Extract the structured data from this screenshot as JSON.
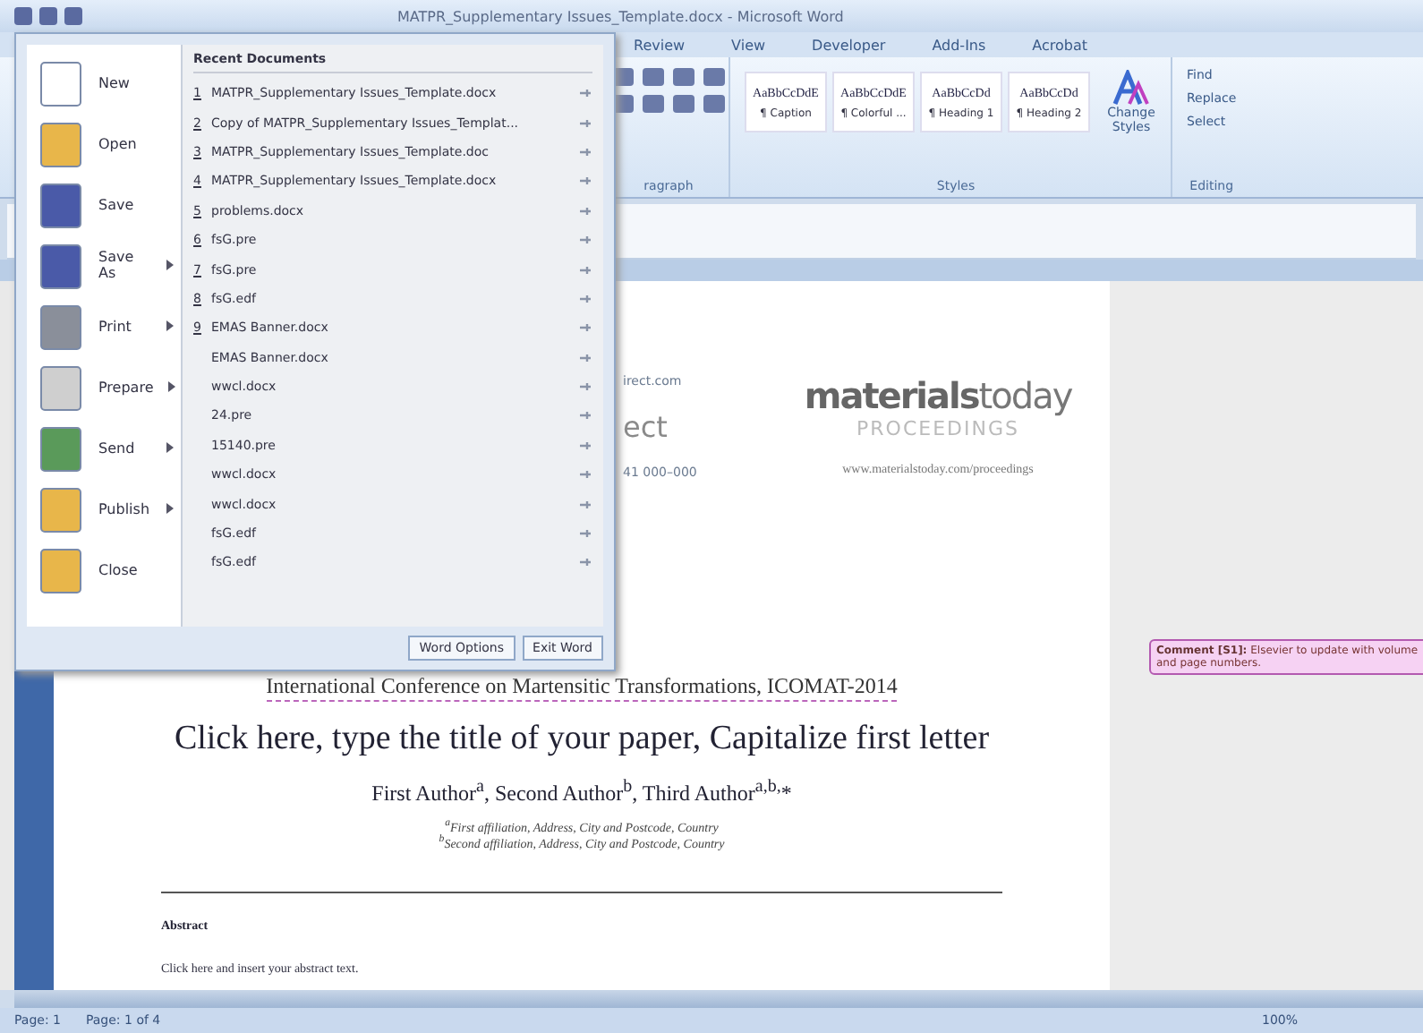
{
  "window": {
    "title": "MATPR_Supplementary Issues_Template.docx - Microsoft Word"
  },
  "ribbon_tabs": [
    {
      "label": "Review",
      "selected": false
    },
    {
      "label": "View",
      "selected": false
    },
    {
      "label": "Developer",
      "selected": false
    },
    {
      "label": "Add-Ins",
      "selected": false
    },
    {
      "label": "Acrobat",
      "selected": false
    }
  ],
  "paragraph_group": {
    "label": "ragraph"
  },
  "styles": [
    {
      "preview": "AaBbCcDdE",
      "name": "¶ Caption"
    },
    {
      "preview": "AaBbCcDdE",
      "name": "¶ Colorful ..."
    },
    {
      "preview": "AaBbCcDd",
      "name": "¶ Heading 1"
    },
    {
      "preview": "AaBbCcDd",
      "name": "¶ Heading 2"
    }
  ],
  "styles_group": {
    "label": "Styles",
    "change_styles": "Change Styles"
  },
  "editing": {
    "items": [
      "Find",
      "Replace",
      "Select"
    ],
    "label": "Editing"
  },
  "office_menu": {
    "commands": [
      {
        "label": "New",
        "submenu": false
      },
      {
        "label": "Open",
        "submenu": false
      },
      {
        "label": "Save",
        "submenu": false
      },
      {
        "label": "Save As",
        "submenu": true
      },
      {
        "label": "Print",
        "submenu": true
      },
      {
        "label": "Prepare",
        "submenu": true
      },
      {
        "label": "Send",
        "submenu": true
      },
      {
        "label": "Publish",
        "submenu": true
      },
      {
        "label": "Close",
        "submenu": false
      }
    ],
    "recent_title": "Recent Documents",
    "recent": [
      {
        "number": "1",
        "name": "MATPR_Supplementary Issues_Template.docx"
      },
      {
        "number": "2",
        "name": "Copy of MATPR_Supplementary Issues_Templat..."
      },
      {
        "number": "3",
        "name": "MATPR_Supplementary Issues_Template.doc"
      },
      {
        "number": "4",
        "name": "MATPR_Supplementary Issues_Template.docx"
      },
      {
        "number": "5",
        "name": "problems.docx"
      },
      {
        "number": "6",
        "name": "fsG.pre"
      },
      {
        "number": "7",
        "name": "fsG.pre"
      },
      {
        "number": "8",
        "name": "fsG.edf"
      },
      {
        "number": "9",
        "name": "EMAS Banner.docx"
      },
      {
        "name": "EMAS Banner.docx"
      },
      {
        "name": "wwcl.docx"
      },
      {
        "name": "24.pre"
      },
      {
        "name": "15140.pre"
      },
      {
        "name": "wwcl.docx"
      },
      {
        "name": "wwcl.docx"
      },
      {
        "name": "fsG.edf"
      },
      {
        "name": "fsG.edf"
      }
    ],
    "buttons": [
      "Word Options",
      "Exit Word"
    ]
  },
  "document": {
    "header_left": [
      "irect.com",
      "ect",
      "41 000–000"
    ],
    "logo_bold": "materials",
    "logo_light": "today",
    "logo_sub": "PROCEEDINGS",
    "website": "www.materialstoday.com/proceedings",
    "conference": "International Conference on Martensitic Transformations, ICOMAT-2014",
    "title": "Click here, type the title of your paper, Capitalize first letter",
    "authors": "First Author$^{a}$, Second Author$^{b}$, Third Author$^{a,b,}$*",
    "affiliations": [
      "$^{a}$First affiliation, Address, City and Postcode, Country",
      "$^{b}$Second affiliation, Address, City and Postcode, Country"
    ],
    "abstract_heading": "Abstract",
    "abstract_text": "Click here and insert your abstract text."
  },
  "comment": {
    "label": "Comment [S1]:",
    "text": "Elsevier to update with volume and page numbers."
  },
  "status_bar": {
    "page": "Page: 1",
    "pages": "Page: 1 of 4",
    "zoom": "100%"
  }
}
